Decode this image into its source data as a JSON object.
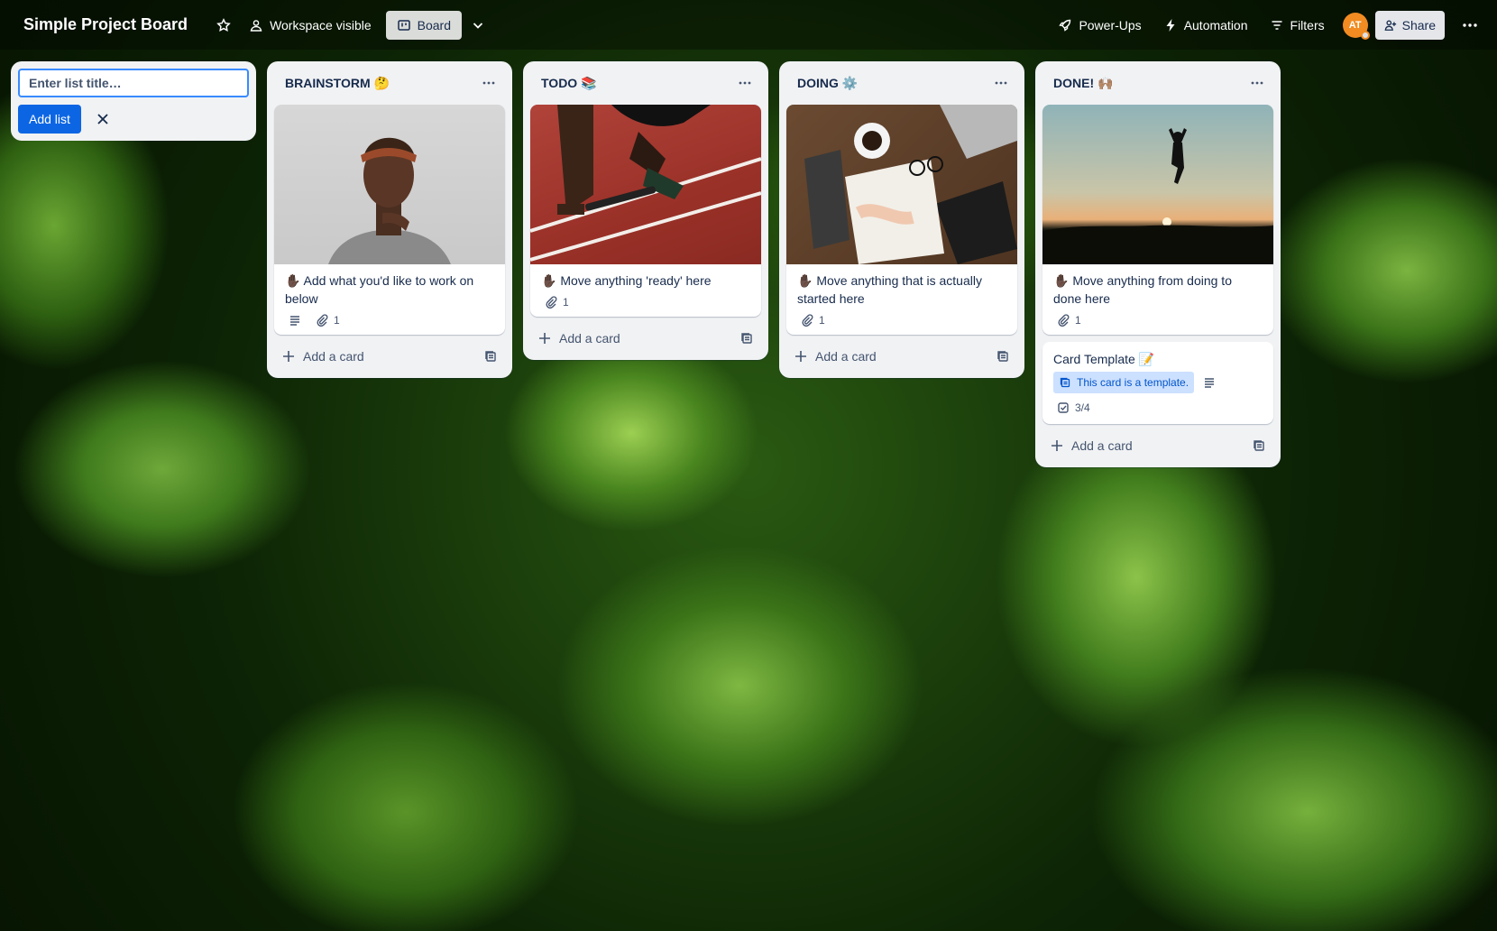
{
  "header": {
    "board_title": "Simple Project Board",
    "visibility_label": "Workspace visible",
    "view_label": "Board",
    "powerups_label": "Power-Ups",
    "automation_label": "Automation",
    "filters_label": "Filters",
    "avatar_initials": "AT",
    "share_label": "Share"
  },
  "add_list": {
    "placeholder": "Enter list title…",
    "button_label": "Add list"
  },
  "lists": [
    {
      "title": "BRAINSTORM 🤔",
      "cards": [
        {
          "title": "✋🏿 Add what you'd like to work on below",
          "has_description": true,
          "attachments": "1"
        }
      ],
      "add_card_label": "Add a card"
    },
    {
      "title": "TODO 📚",
      "cards": [
        {
          "title": "✋🏿 Move anything 'ready' here",
          "attachments": "1"
        }
      ],
      "add_card_label": "Add a card"
    },
    {
      "title": "DOING ⚙️",
      "cards": [
        {
          "title": "✋🏿 Move anything that is actually started here",
          "attachments": "1"
        }
      ],
      "add_card_label": "Add a card"
    },
    {
      "title": "DONE! 🙌🏽",
      "cards": [
        {
          "title": "✋🏿 Move anything from doing to done here",
          "attachments": "1"
        },
        {
          "title": "Card Template 📝",
          "template_badge": "This card is a template.",
          "checklist": "3/4"
        }
      ],
      "add_card_label": "Add a card"
    }
  ],
  "colors": {
    "primary": "#0c66e4",
    "list_bg": "#f1f2f4",
    "avatar_bg": "#f18b22",
    "template_badge_bg": "#cce0ff"
  }
}
